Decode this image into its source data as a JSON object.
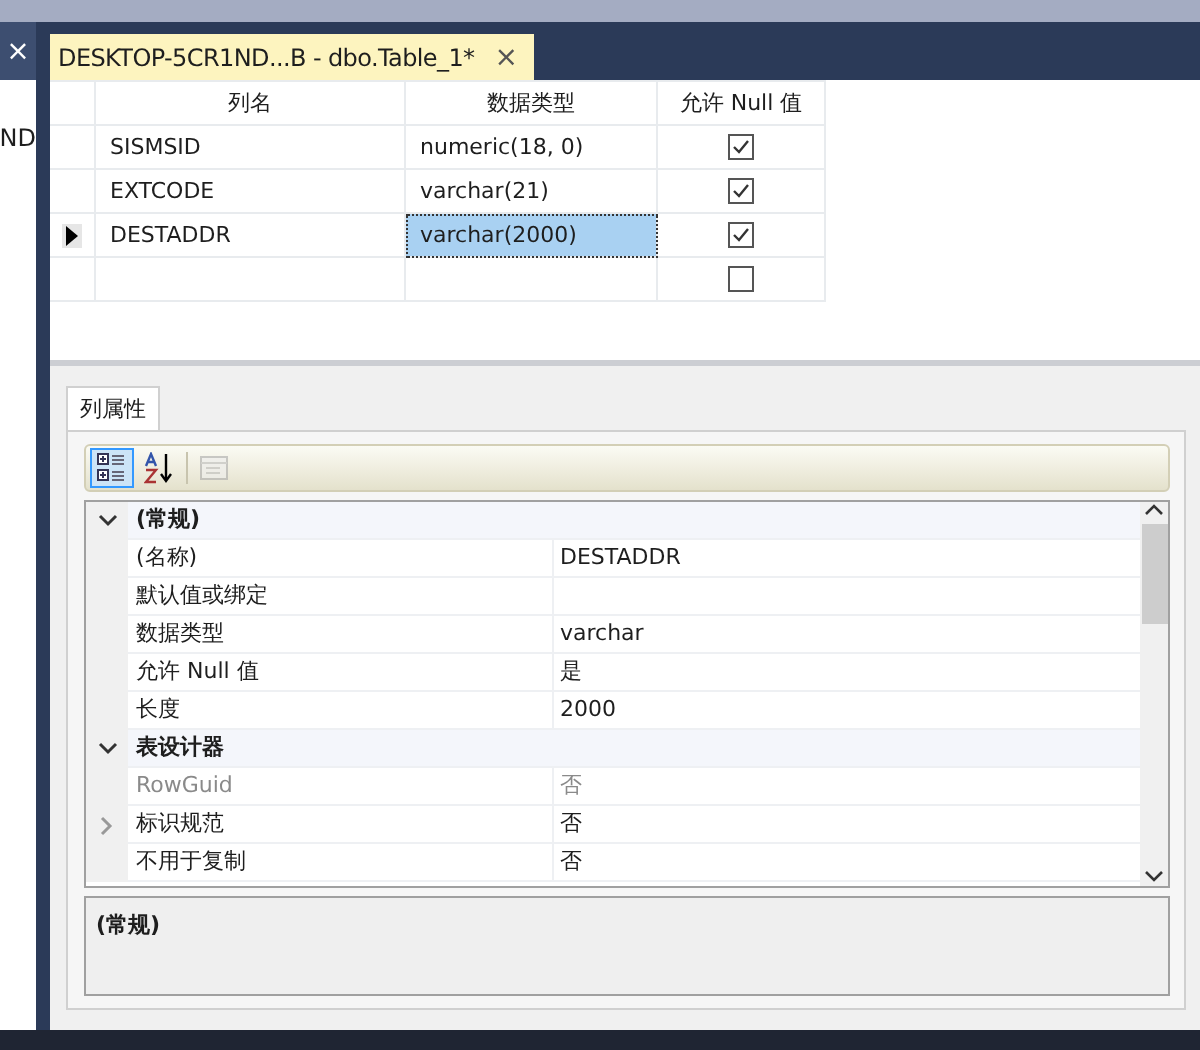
{
  "left_panel": {
    "close": "×",
    "text": "ND"
  },
  "document_tab": {
    "title": "DESKTOP-5CR1ND...B - dbo.Table_1*",
    "close": "×",
    "selected": true
  },
  "table": {
    "columns": [
      "列名",
      "数据类型",
      "允许 Null 值"
    ],
    "rows": [
      {
        "name": "SISMSID",
        "type": "numeric(18, 0)",
        "allow_null": true,
        "current": false,
        "selected": false
      },
      {
        "name": "EXTCODE",
        "type": "varchar(21)",
        "allow_null": true,
        "current": false,
        "selected": false
      },
      {
        "name": "DESTADDR",
        "type": "varchar(2000)",
        "allow_null": true,
        "current": true,
        "selected": true
      },
      {
        "name": "",
        "type": "",
        "allow_null": false,
        "current": false,
        "selected": false
      }
    ]
  },
  "properties_tab": {
    "label": "列属性",
    "selected": true
  },
  "toolbar": [
    {
      "kind": "categorized",
      "selected": true,
      "disabled": false
    },
    {
      "kind": "alphabetical",
      "selected": false,
      "disabled": false
    },
    {
      "kind": "pages",
      "selected": false,
      "disabled": true
    }
  ],
  "categories": [
    {
      "name": "(常规)",
      "expanded": true,
      "items": [
        {
          "name": "(名称)",
          "value": "DESTADDR",
          "disabled": false,
          "expandable": false
        },
        {
          "name": "默认值或绑定",
          "value": "",
          "disabled": false,
          "expandable": false
        },
        {
          "name": "数据类型",
          "value": "varchar",
          "disabled": false,
          "expandable": false
        },
        {
          "name": "允许 Null 值",
          "value": "是",
          "disabled": false,
          "expandable": false
        },
        {
          "name": "长度",
          "value": "2000",
          "disabled": false,
          "expandable": false
        }
      ]
    },
    {
      "name": "表设计器",
      "expanded": true,
      "items": [
        {
          "name": "RowGuid",
          "value": "否",
          "disabled": true,
          "expandable": false
        },
        {
          "name": "标识规范",
          "value": "否",
          "disabled": false,
          "expandable": true
        },
        {
          "name": "不用于复制",
          "value": "否",
          "disabled": false,
          "expandable": false
        }
      ]
    }
  ],
  "description": {
    "title": "(常规)"
  }
}
